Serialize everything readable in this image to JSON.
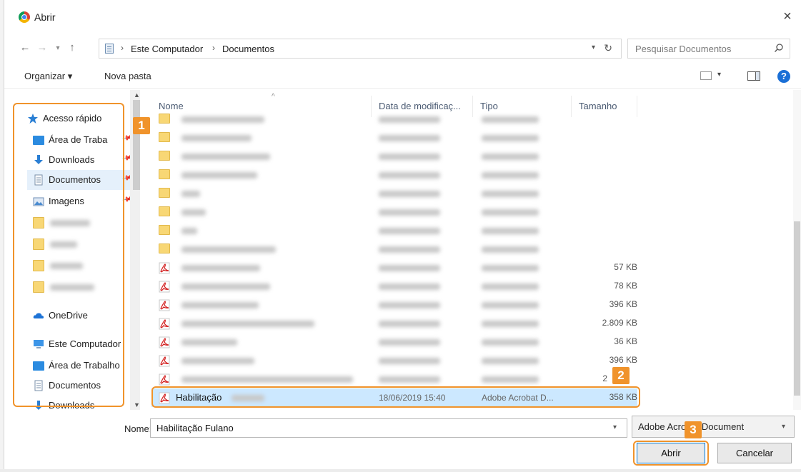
{
  "window": {
    "title": "Abrir",
    "close_glyph": "×"
  },
  "address": {
    "crumbs": [
      "Este Computador",
      "Documentos"
    ],
    "separator": "›"
  },
  "search": {
    "placeholder": "Pesquisar Documentos"
  },
  "toolbar": {
    "organize_label": "Organizar ▾",
    "new_folder_label": "Nova pasta"
  },
  "nav": {
    "quick_access": "Acesso rápido",
    "items": [
      "Área de Traba",
      "Downloads",
      "Documentos",
      "Imagens"
    ],
    "onedrive": "OneDrive",
    "this_pc": "Este Computador",
    "pc_items": [
      "Área de Trabalho",
      "Documentos",
      "Downloads"
    ]
  },
  "columns": {
    "name": "Nome",
    "date": "Data de modificaç...",
    "type": "Tipo",
    "size": "Tamanho"
  },
  "pdf_sizes": [
    "57 KB",
    "78 KB",
    "396 KB",
    "2.809 KB",
    "36 KB",
    "396 KB",
    "2"
  ],
  "selected_file": {
    "name": "Habilitação",
    "date": "18/06/2019 15:40",
    "type": "Adobe Acrobat D...",
    "size": "358 KB"
  },
  "bottom": {
    "name_label": "Nome:",
    "name_value": "Habilitação Fulano",
    "file_type": "Adobe Acrobat Document",
    "open_label": "Abrir",
    "cancel_label": "Cancelar"
  },
  "annotations": {
    "badge_1": "1",
    "badge_2": "2",
    "badge_3": "3",
    "color": "#f0932b"
  },
  "colors": {
    "accent": "#0078d7",
    "selection": "#cce8ff",
    "folder": "#f8d775"
  },
  "icons": [
    "chrome-icon",
    "back-arrow-icon",
    "forward-arrow-icon",
    "up-arrow-icon",
    "refresh-icon",
    "search-icon",
    "view-options-icon",
    "preview-pane-icon",
    "help-icon",
    "star-icon",
    "desktop-icon",
    "download-icon",
    "document-icon",
    "pictures-icon",
    "folder-icon",
    "onedrive-icon",
    "computer-icon",
    "pdf-icon",
    "pin-icon"
  ]
}
